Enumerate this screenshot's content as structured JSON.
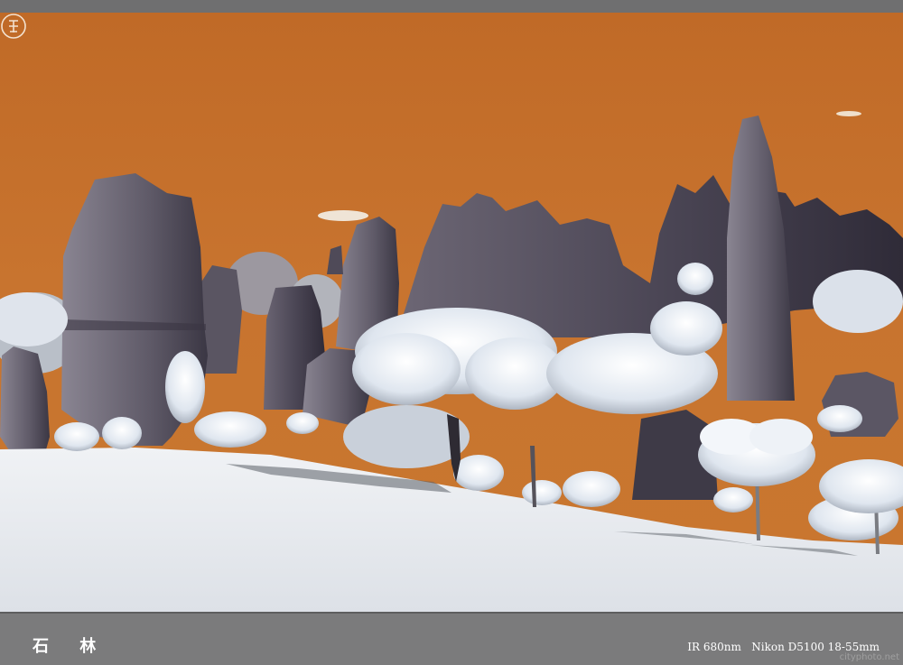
{
  "photo": {
    "alt": "Stone Forest infrared landscape",
    "sky_color": "#c6712d",
    "ground_color": "#e9ecf0",
    "rock_color": "#4f4a58",
    "foliage_color": "#dfe6ef",
    "logo_icon": "seal-logo-icon"
  },
  "caption": {
    "title": "石 林",
    "info": "IR 680nm   Nikon D5100 18-55mm",
    "site": "cityphoto.net"
  }
}
